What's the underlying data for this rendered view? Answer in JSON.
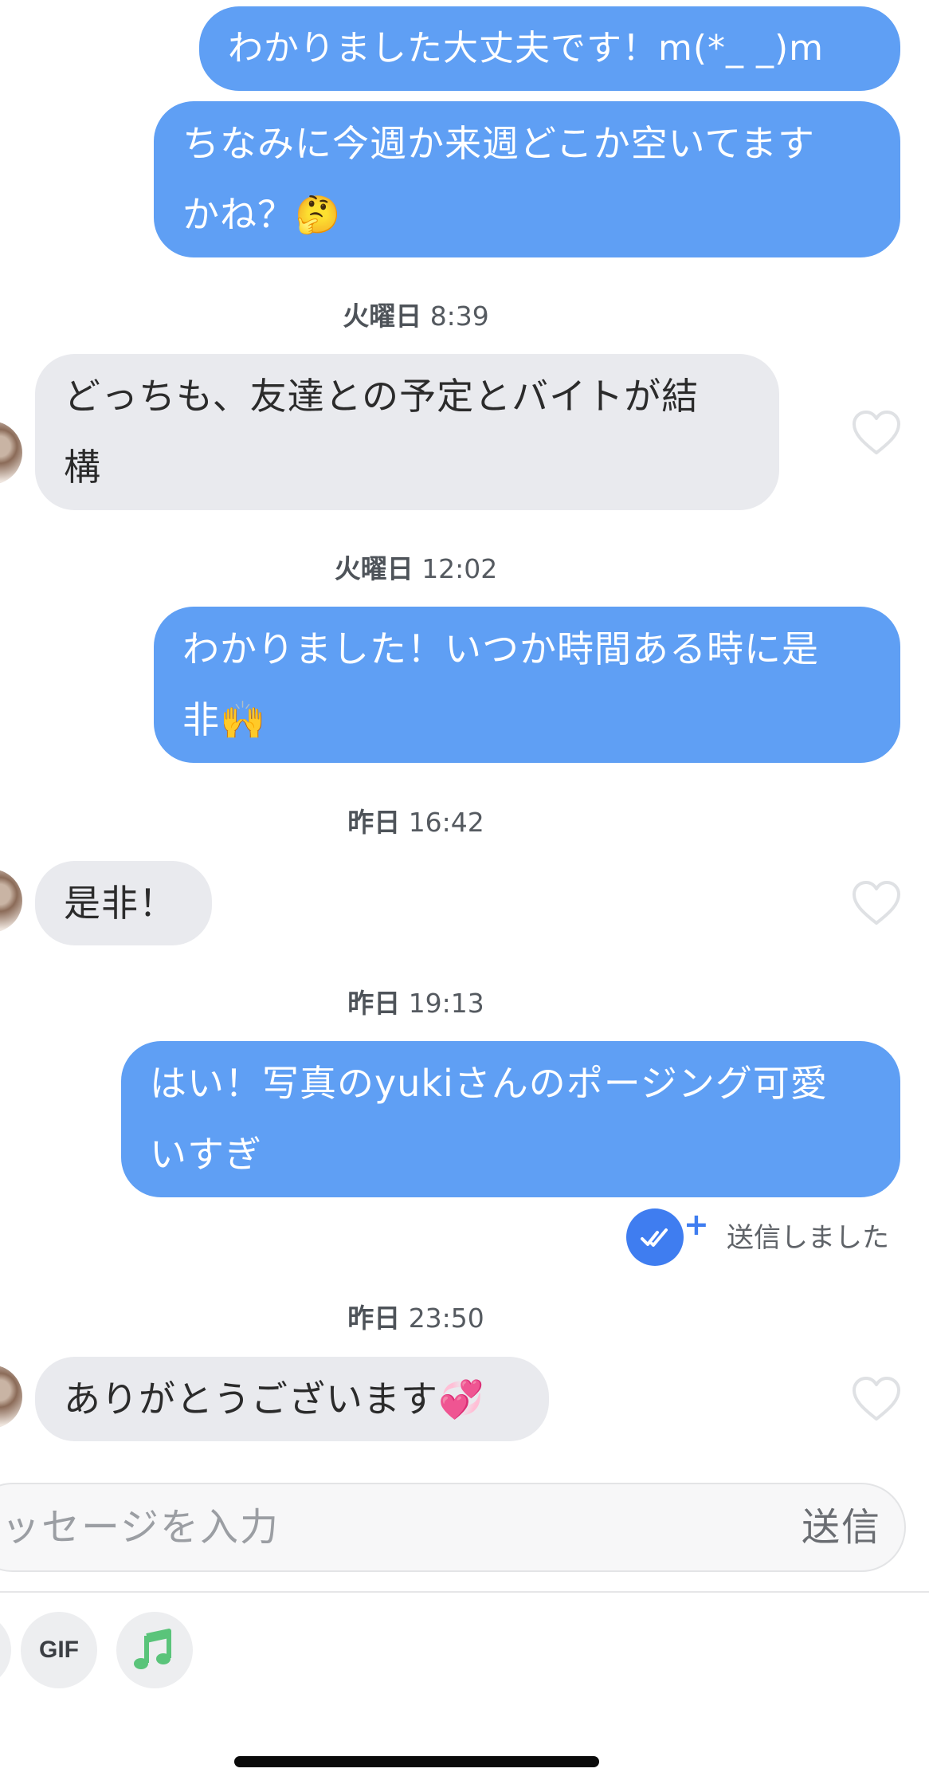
{
  "messages": [
    {
      "dir": "out",
      "lines": [
        "わかりました大丈夫です！m(*_ _)m"
      ]
    },
    {
      "dir": "out",
      "lines": [
        "ちなみに今週か来週どこか空いてます",
        "かね？🤔"
      ]
    },
    {
      "dir": "timestamp",
      "day": "火曜日",
      "time": "8:39"
    },
    {
      "dir": "in",
      "lines": [
        "どっちも、友達との予定とバイトが結",
        "構"
      ]
    },
    {
      "dir": "timestamp",
      "day": "火曜日",
      "time": "12:02"
    },
    {
      "dir": "out",
      "lines": [
        "わかりました！いつか時間ある時に是",
        "非🙌"
      ]
    },
    {
      "dir": "timestamp",
      "day": "昨日",
      "time": "16:42"
    },
    {
      "dir": "in",
      "lines": [
        "是非！"
      ]
    },
    {
      "dir": "timestamp",
      "day": "昨日",
      "time": "19:13"
    },
    {
      "dir": "out",
      "lines": [
        "はい！写真のyukiさんのポージング可愛",
        "いすぎ"
      ]
    },
    {
      "dir": "timestamp",
      "day": "昨日",
      "time": "23:50"
    },
    {
      "dir": "in",
      "lines": [
        "ありがとうございます💞"
      ]
    }
  ],
  "status": {
    "sent_label": "送信しました",
    "plus": "+"
  },
  "composer": {
    "placeholder": "メッセージを入力",
    "send_label": "送信"
  },
  "toolbar": {
    "gif_label": "GIF"
  },
  "colors": {
    "outgoing_bubble": "#5f9ff4",
    "incoming_bubble": "#e9eaee",
    "accent": "#3f7df0",
    "music_icon": "#5ac47a"
  },
  "icons": [
    "heart-outline-icon",
    "double-check-icon",
    "music-note-icon"
  ]
}
